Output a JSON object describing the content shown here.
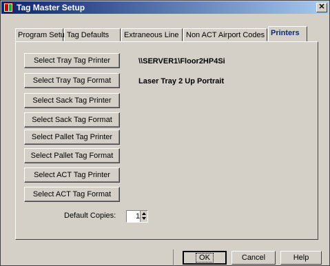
{
  "window": {
    "title": "Tag Master Setup",
    "close_label": "✕"
  },
  "tabs": [
    {
      "label": "Program Setup"
    },
    {
      "label": "Tag Defaults"
    },
    {
      "label": "Extraneous Line"
    },
    {
      "label": "Non ACT Airport Codes"
    },
    {
      "label": "Printers",
      "active": true
    }
  ],
  "buttons": [
    {
      "label": "Select Tray Tag Printer"
    },
    {
      "label": "Select Tray Tag Format"
    },
    {
      "label": "Select Sack Tag Printer"
    },
    {
      "label": "Select Sack Tag Format"
    },
    {
      "label": "Select Pallet Tag Printer"
    },
    {
      "label": "Select Pallet Tag Format"
    },
    {
      "label": "Select ACT Tag Printer"
    },
    {
      "label": "Select ACT Tag Format"
    }
  ],
  "values": {
    "tray_printer": "\\\\SERVER1\\Floor2HP4Si",
    "tray_format": "Laser Tray 2 Up Portrait"
  },
  "default_copies": {
    "label": "Default Copies:",
    "value": "1"
  },
  "footer": {
    "ok": "OK",
    "cancel": "Cancel",
    "help": "Help"
  }
}
